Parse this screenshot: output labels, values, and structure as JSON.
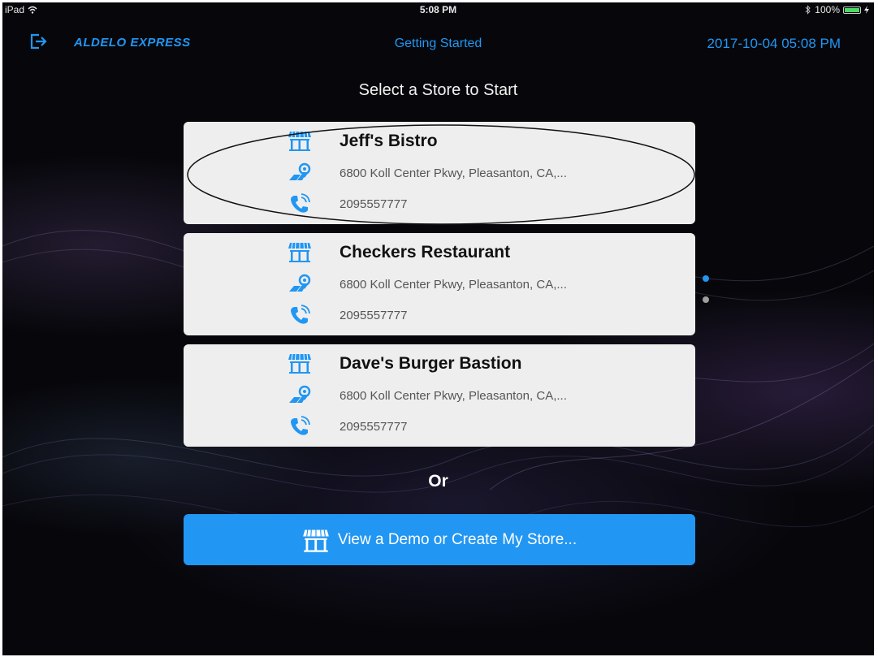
{
  "status_bar": {
    "device": "iPad",
    "time": "5:08 PM",
    "battery": "100%"
  },
  "nav": {
    "brand": "ALDELO EXPRESS",
    "title": "Getting Started",
    "datetime": "2017-10-04 05:08 PM"
  },
  "heading": "Select a Store to Start",
  "stores": [
    {
      "name": "Jeff's Bistro",
      "address": "6800 Koll Center Pkwy, Pleasanton, CA,...",
      "phone": "2095557777"
    },
    {
      "name": "Checkers Restaurant",
      "address": "6800 Koll Center Pkwy, Pleasanton, CA,...",
      "phone": "2095557777"
    },
    {
      "name": "Dave's Burger Bastion",
      "address": "6800 Koll Center Pkwy, Pleasanton, CA,...",
      "phone": "2095557777"
    }
  ],
  "pagination": {
    "pages": 2,
    "current": 1
  },
  "or_label": "Or",
  "demo_button": {
    "label": "View a Demo or Create My Store..."
  },
  "icons": {
    "store": "storefront-icon",
    "address": "location-pin-icon",
    "phone": "phone-icon",
    "exit": "exit-icon"
  },
  "colors": {
    "accent": "#2196f3",
    "card_bg": "#eeeeee",
    "dot_inactive": "#9e9e9e"
  }
}
